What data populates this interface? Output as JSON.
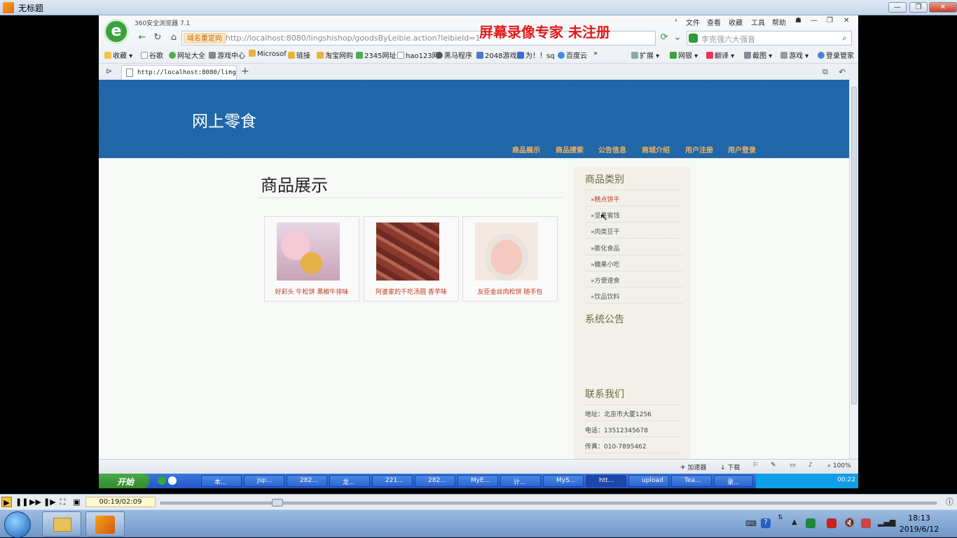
{
  "player": {
    "window_title": "无标题",
    "time_display": "00:19/02:09",
    "progress_fraction": 0.15
  },
  "browser": {
    "name_version": "360安全浏览器 7.1",
    "top_menu": [
      "文件",
      "查看",
      "收藏",
      "工具",
      "帮助"
    ],
    "address_tag": "域名重定向",
    "url": "http://localhost:8080/lingshishop/goodsByLeibie.action?leibieId=1",
    "watermark": "屏幕录像专家  未注册",
    "search_placeholder": "李克强六大强音",
    "bookmarks": [
      "收藏",
      "谷歌",
      "网址大全",
      "游戏中心",
      "Microsof",
      "链接",
      "淘宝网购",
      "2345网址",
      "hao123网",
      "黑马程序",
      "2048游戏",
      "为！！sq",
      "百度云"
    ],
    "toolbar_right": [
      "扩展",
      "网银",
      "翻译",
      "截图",
      "游戏",
      "登录管家"
    ],
    "tab_label": "http://localhost:8080/lings",
    "status_items": [
      "加速器",
      "下载",
      "100%"
    ]
  },
  "site": {
    "title": "网上零食",
    "nav": [
      "商品展示",
      "商品搜索",
      "公告信息",
      "商城介绍",
      "用户注册",
      "用户登录"
    ],
    "main_title": "商品展示",
    "products": [
      {
        "name": "好彩头 牛松饼 黑椒牛排味"
      },
      {
        "name": "阿婆家的千吃汤圆 香芋味"
      },
      {
        "name": "友臣金丝肉松饼 随手包"
      }
    ],
    "sidebar": {
      "categories_title": "商品类别",
      "categories": [
        "糕点饼干",
        "坚果蜜饯",
        "肉类豆干",
        "膨化食品",
        "糖果小吃",
        "方便速食",
        "饮品饮料"
      ],
      "notice_title": "系统公告",
      "contact_title": "联系我们",
      "contact": [
        "地址：北京市大厦1256",
        "电话：13512345678",
        "传真：010-7895462"
      ]
    }
  },
  "xp_taskbar": {
    "start": "开始",
    "items": [
      "本...",
      "jsp...",
      "282...",
      "龙...",
      "221...",
      "282...",
      "MyE...",
      "计...",
      "MyS...",
      "htt...",
      "upload",
      "Tea...",
      "录..."
    ],
    "time": "00:22"
  },
  "taskbar": {
    "time": "18:13",
    "date": "2019/6/12"
  }
}
